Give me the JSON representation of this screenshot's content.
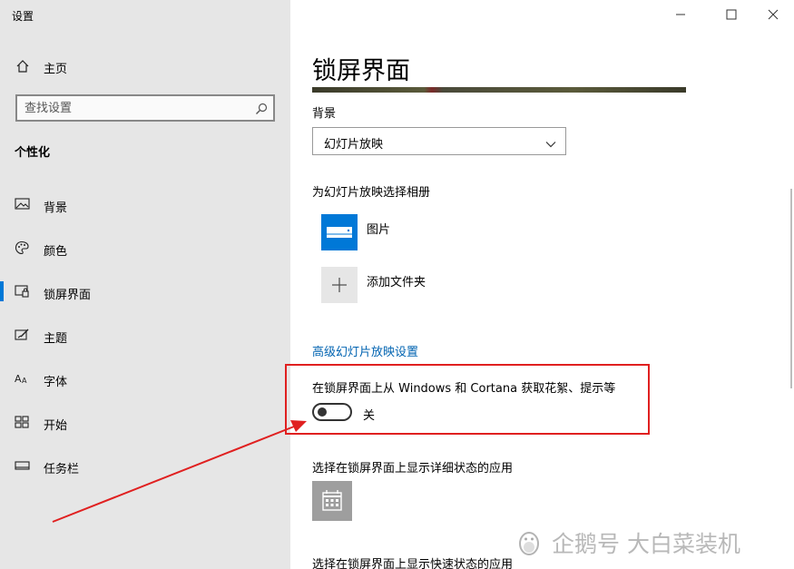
{
  "window": {
    "title": "设置"
  },
  "sidebar": {
    "home_label": "主页",
    "search_placeholder": "查找设置",
    "section_title": "个性化",
    "items": [
      {
        "label": "背景",
        "icon": "image-icon",
        "selected": false
      },
      {
        "label": "颜色",
        "icon": "palette-icon",
        "selected": false
      },
      {
        "label": "锁屏界面",
        "icon": "lock-screen-icon",
        "selected": true
      },
      {
        "label": "主题",
        "icon": "theme-icon",
        "selected": false
      },
      {
        "label": "字体",
        "icon": "font-icon",
        "selected": false
      },
      {
        "label": "开始",
        "icon": "start-icon",
        "selected": false
      },
      {
        "label": "任务栏",
        "icon": "taskbar-icon",
        "selected": false
      }
    ]
  },
  "main": {
    "page_title": "锁屏界面",
    "background_label": "背景",
    "background_value": "幻灯片放映",
    "album_label": "为幻灯片放映选择相册",
    "albums": [
      {
        "label": "图片",
        "icon": "pictures-folder-icon"
      },
      {
        "label": "添加文件夹",
        "icon": "add-icon"
      }
    ],
    "advanced_link": "高级幻灯片放映设置",
    "spotlight_label": "在锁屏界面上从 Windows 和 Cortana 获取花絮、提示等",
    "spotlight_state": "关",
    "spotlight_on": false,
    "detailed_status_label": "选择在锁屏界面上显示详细状态的应用",
    "quick_status_label": "选择在锁屏界面上显示快速状态的应用"
  },
  "watermark": {
    "text": "企鹅号 大白菜装机"
  },
  "colors": {
    "accent": "#0078d7",
    "sidebar_bg": "#e6e6e6",
    "annotation": "#e02020",
    "link": "#0063b1"
  }
}
